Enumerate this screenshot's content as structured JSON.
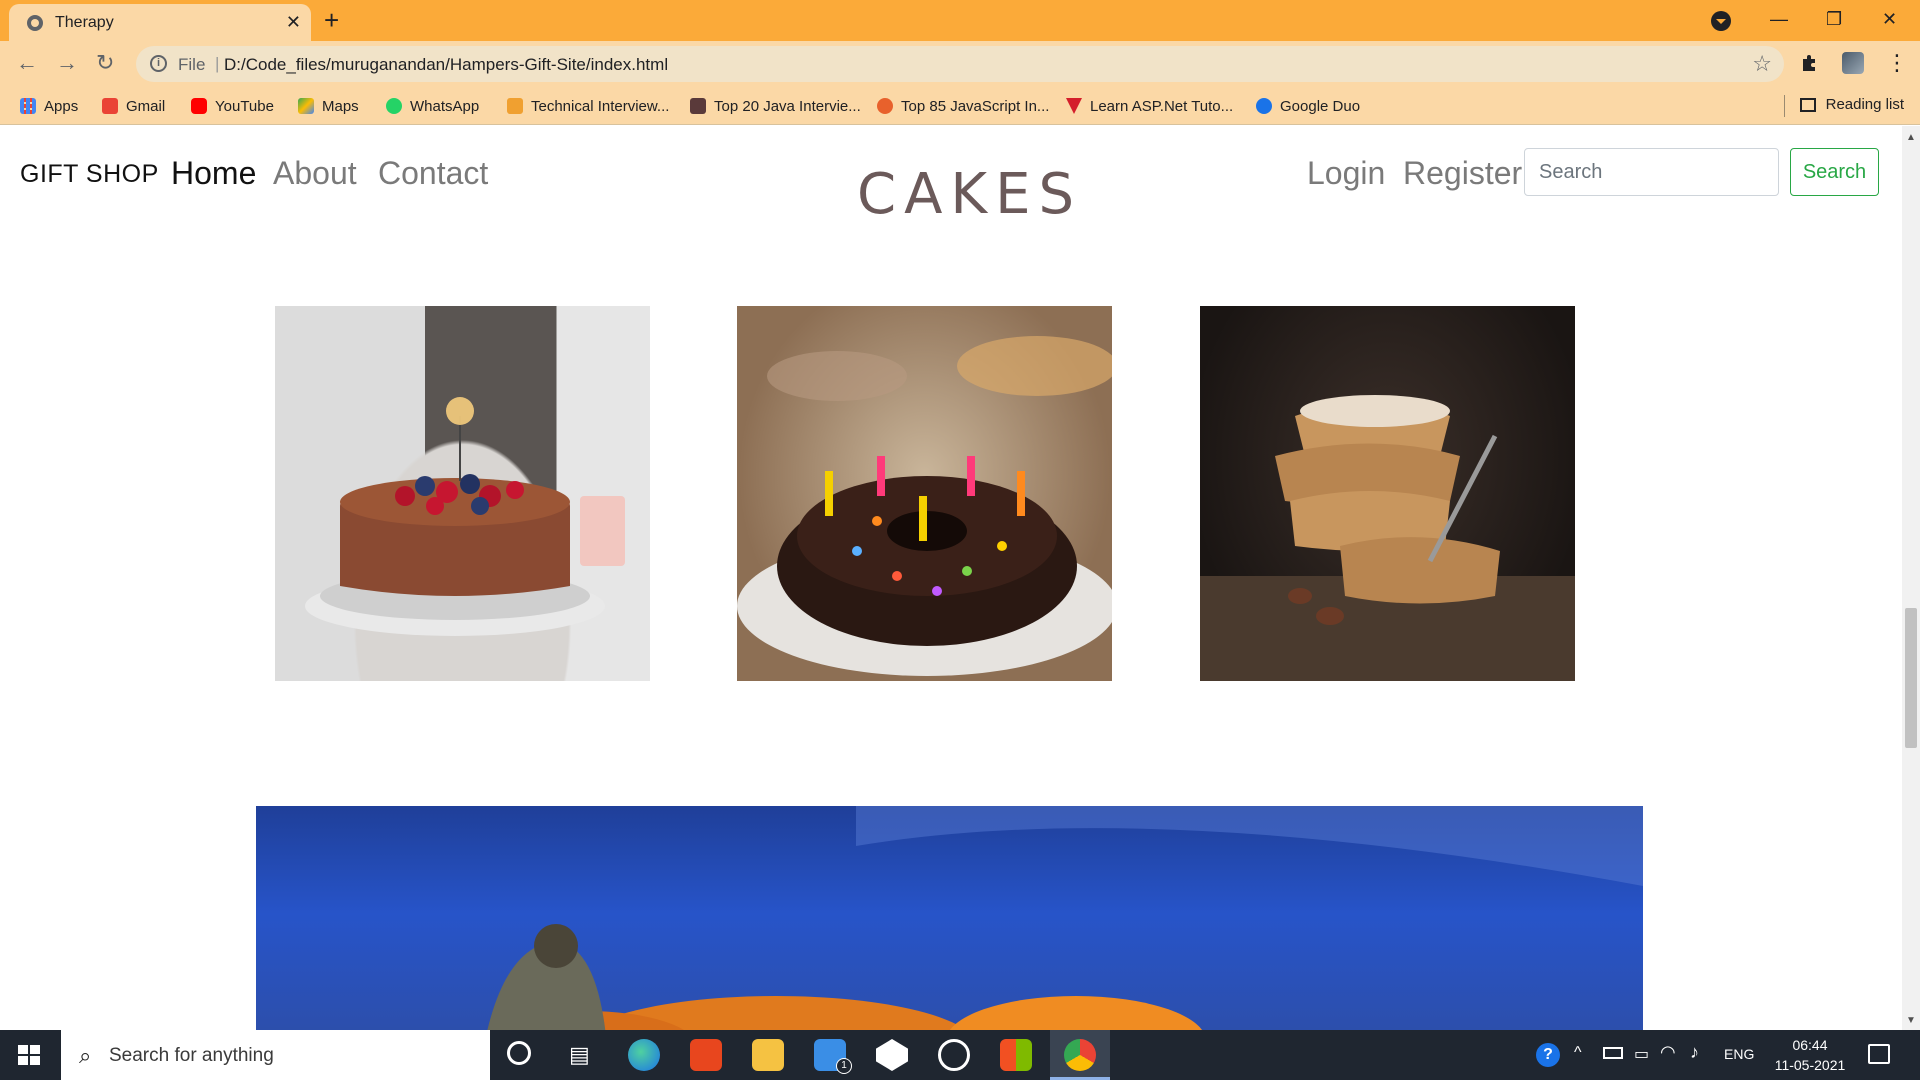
{
  "browser": {
    "tab_title": "Therapy",
    "url_scheme": "File",
    "url": "D:/Code_files/muruganandan/Hampers-Gift-Site/index.html",
    "bookmarks": [
      {
        "label": "Apps",
        "color": "#4285f4"
      },
      {
        "label": "Gmail",
        "color": "#ea4335"
      },
      {
        "label": "YouTube",
        "color": "#ff0000"
      },
      {
        "label": "Maps",
        "color": "#34a853"
      },
      {
        "label": "WhatsApp",
        "color": "#25d366"
      },
      {
        "label": "Technical Interview...",
        "color": "#f0a030"
      },
      {
        "label": "Top 20 Java Intervie...",
        "color": "#5a3a3a"
      },
      {
        "label": "Top 85 JavaScript In...",
        "color": "#e8612c"
      },
      {
        "label": "Learn ASP.Net Tuto...",
        "color": "#d41f2b"
      },
      {
        "label": "Google Duo",
        "color": "#1a73e8"
      }
    ],
    "reading_list": "Reading list"
  },
  "site": {
    "brand": "GIFT SHOP",
    "nav": {
      "home": "Home",
      "about": "About",
      "contact": "Contact",
      "login": "Login",
      "register": "Register"
    },
    "section_title": "CAKES",
    "search": {
      "placeholder": "Search",
      "button": "Search",
      "button_color": "#28a745"
    }
  },
  "taskbar": {
    "search_placeholder": "Search for anything",
    "language": "ENG",
    "time": "06:44",
    "date": "11-05-2021",
    "mail_badge": "1"
  }
}
